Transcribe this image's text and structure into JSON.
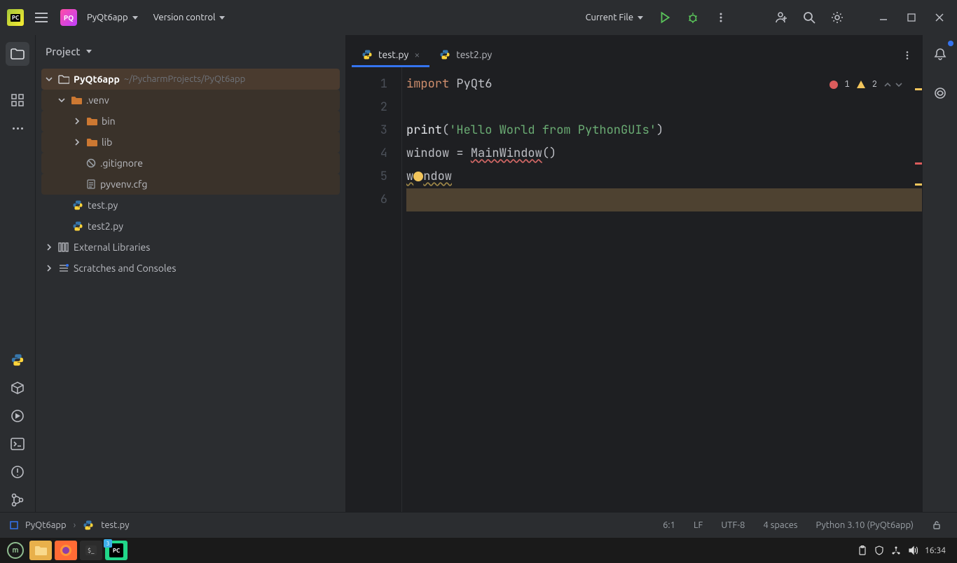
{
  "titlebar": {
    "project_badge": "PQ",
    "project_name": "PyQt6app",
    "vcs": "Version control",
    "run_config": "Current File"
  },
  "project_panel": {
    "title": "Project",
    "root": {
      "name": "PyQt6app",
      "path": "~/PycharmProjects/PyQt6app"
    },
    "venv": {
      "name": ".venv",
      "bin": "bin",
      "lib": "lib",
      "gitignore": ".gitignore",
      "pyvenv": "pyvenv.cfg"
    },
    "files": {
      "test": "test.py",
      "test2": "test2.py"
    },
    "external": "External Libraries",
    "scratches": "Scratches and Consoles"
  },
  "tabs": {
    "tab1": "test.py",
    "tab2": "test2.py"
  },
  "editor": {
    "l1a": "import",
    "l1b": " PyQt6",
    "l3a": "print",
    "l3b": "(",
    "l3c": "'Hello World from PythonGUIs'",
    "l3d": ")",
    "l4a": "window = ",
    "l4b": "MainWindow",
    "l4c": "()",
    "l5a": "w",
    "l5b": "ndow",
    "ln1": "1",
    "ln2": "2",
    "ln3": "3",
    "ln4": "4",
    "ln5": "5",
    "ln6": "6",
    "err_count": "1",
    "warn_count": "2"
  },
  "breadcrumb": {
    "project": "PyQt6app",
    "file": "test.py"
  },
  "statusbar": {
    "pos": "6:1",
    "eol": "LF",
    "enc": "UTF-8",
    "indent": "4 spaces",
    "interp": "Python 3.10 (PyQt6app)"
  },
  "taskbar": {
    "time": "16:34"
  }
}
